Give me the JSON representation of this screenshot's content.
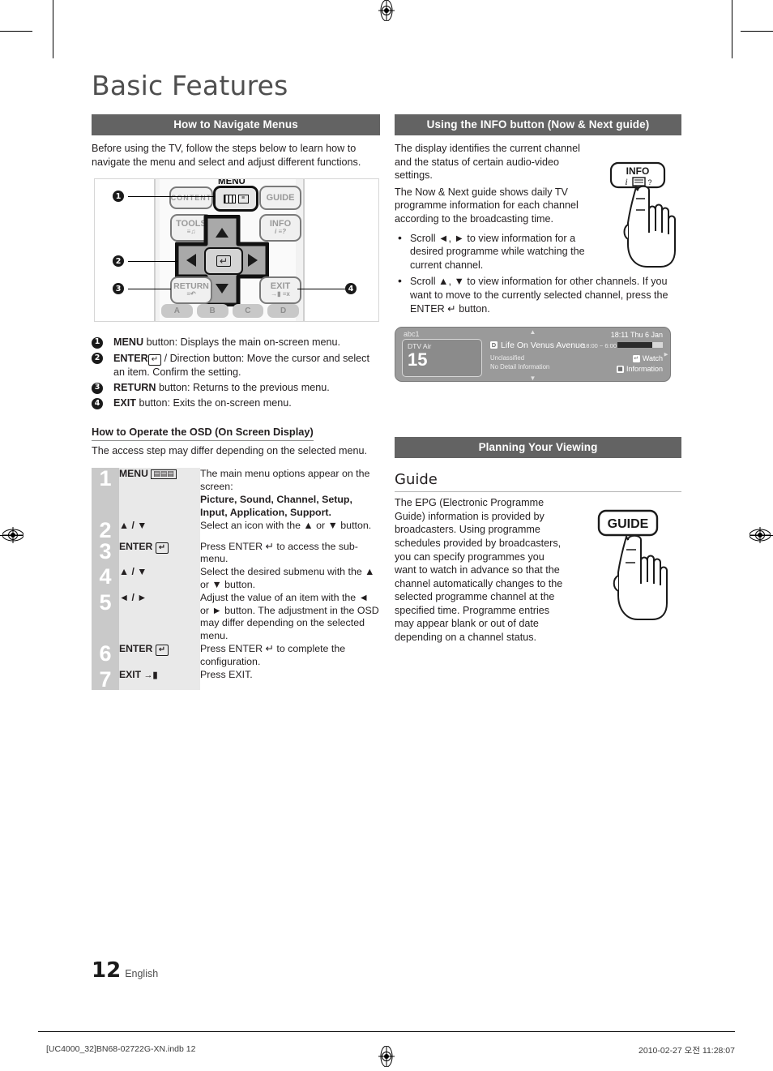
{
  "page": {
    "title": "Basic Features",
    "page_number": "12",
    "language": "English"
  },
  "left": {
    "section_title": "How to Navigate Menus",
    "intro": "Before using the TV, follow the steps below to learn how to navigate the menu and select and adjust different functions.",
    "remote": {
      "menu_label": "MENU",
      "buttons": {
        "content": "CONTENT",
        "menu": "MENU",
        "guide": "GUIDE",
        "tools": "TOOLS",
        "info": "INFO",
        "return": "RETURN",
        "exit": "EXIT"
      },
      "color_buttons": [
        "A",
        "B",
        "C",
        "D"
      ],
      "callouts": [
        "1",
        "2",
        "3",
        "4"
      ]
    },
    "legend": [
      {
        "num": "1",
        "bold": "MENU",
        "text": " button: Displays the main on-screen menu."
      },
      {
        "num": "2",
        "bold": "ENTER",
        "text": " / Direction button: Move the cursor and select an item. Confirm the setting."
      },
      {
        "num": "3",
        "bold": "RETURN",
        "text": " button: Returns to the previous menu."
      },
      {
        "num": "4",
        "bold": "EXIT",
        "text": " button: Exits the on-screen menu."
      }
    ],
    "osd_heading": "How to Operate the OSD (On Screen Display)",
    "osd_intro": "The access step may differ depending on the selected menu.",
    "steps": [
      {
        "num": "1",
        "key": "MENU",
        "key_glyph": "menu-icon",
        "desc": "The main menu options appear on the screen:",
        "desc_bold": "Picture, Sound, Channel, Setup, Input, Application, Support."
      },
      {
        "num": "2",
        "key": "▲ / ▼",
        "key_glyph": "",
        "desc": "Select an icon with the ▲ or ▼ button.",
        "desc_bold": ""
      },
      {
        "num": "3",
        "key": "ENTER",
        "key_glyph": "enter-icon",
        "desc": "Press ENTER ↵ to access the sub-menu.",
        "desc_bold": ""
      },
      {
        "num": "4",
        "key": "▲ / ▼",
        "key_glyph": "",
        "desc": "Select the desired submenu with the ▲ or ▼ button.",
        "desc_bold": ""
      },
      {
        "num": "5",
        "key": "◄ / ►",
        "key_glyph": "",
        "desc": "Adjust the value of an item with the ◄ or ► button. The adjustment in the OSD may differ depending on the selected menu.",
        "desc_bold": ""
      },
      {
        "num": "6",
        "key": "ENTER",
        "key_glyph": "enter-icon",
        "desc": "Press ENTER ↵ to complete the configuration.",
        "desc_bold": ""
      },
      {
        "num": "7",
        "key": "EXIT",
        "key_glyph": "exit-icon",
        "desc": "Press EXIT.",
        "desc_bold": ""
      }
    ]
  },
  "right": {
    "section_title": "Using the INFO button (Now & Next guide)",
    "para1": "The display identifies the current channel and the status of certain audio-video settings.",
    "para2": "The Now & Next guide shows daily TV programme information for each channel according to the broadcasting time.",
    "bullets": [
      "Scroll ◄, ► to view information for a desired programme while watching the current channel.",
      "Scroll ▲, ▼ to view information for other channels. If you want to move to the currently selected channel, press the ENTER ↵ button."
    ],
    "info_button_label": "INFO",
    "osd": {
      "network": "abc1",
      "source": "DTV Air",
      "channel_number": "15",
      "programme": "Life On Venus Avenue",
      "programme_tag": "D",
      "rating": "Unclassified",
      "detail": "No Detail Information",
      "clock": "18:11 Thu 6 Jan",
      "time_range": "18:00 ~ 6:00",
      "progress_percent": 77,
      "watch": "Watch",
      "information": "Information"
    },
    "section_title2": "Planning Your Viewing",
    "guide_heading": "Guide",
    "guide_text": "The EPG (Electronic Programme Guide) information is provided by broadcasters. Using programme schedules provided by broadcasters, you can specify programmes you want to watch in advance so that the channel automatically changes to the selected programme channel at the specified time. Programme entries may appear blank or out of date depending on a channel status.",
    "guide_button_label": "GUIDE"
  },
  "footer": {
    "file": "[UC4000_32]BN68-02722G-XN.indb   12",
    "timestamp": "2010-02-27   오전 11:28:07"
  },
  "colors": {
    "section_bar": "#636363",
    "step_number_bg": "#c9c9c9",
    "step_key_bg": "#e9e9e9",
    "osd_bg": "#9a9a9a"
  }
}
